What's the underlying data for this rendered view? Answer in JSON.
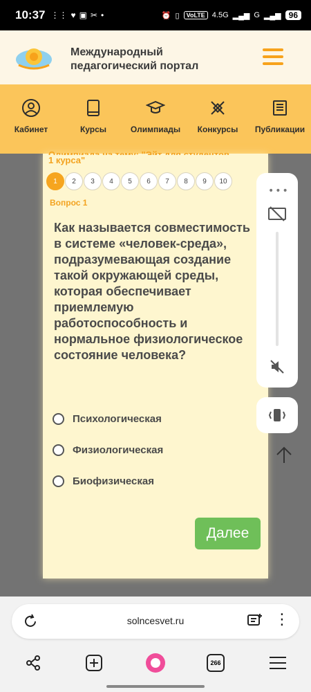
{
  "status_bar": {
    "time": "10:37",
    "volte": "VoLTE",
    "net_45g": "4.5G",
    "net_g": "G",
    "battery": "96"
  },
  "header": {
    "title_line1": "Международный",
    "title_line2": "педагогический портал"
  },
  "nav": {
    "items": [
      {
        "label": "Кабинет",
        "icon": "user-circle-icon"
      },
      {
        "label": "Курсы",
        "icon": "book-icon"
      },
      {
        "label": "Олимпиады",
        "icon": "graduation-cap-icon"
      },
      {
        "label": "Конкурсы",
        "icon": "pen-tools-icon"
      },
      {
        "label": "Публикации",
        "icon": "newspaper-icon"
      }
    ]
  },
  "quiz": {
    "subtitle_line1": "Олимпиада на тему: \"Эйт для студентов",
    "subtitle_line2": "1 курса\"",
    "pages": [
      "1",
      "2",
      "3",
      "4",
      "5",
      "6",
      "7",
      "8",
      "9",
      "10"
    ],
    "active_page": "1",
    "question_number": "Вопрос 1",
    "question_text": "Как называется совместимость в системе «человек-среда», подразумевающая создание такой окружающей среды, которая обеспечивает приемлемую работоспособность и нормальное физиологическое состояние человека?",
    "options": [
      "Психологическая",
      "Физиологическая",
      "Биофизическая"
    ],
    "next_label": "Далее"
  },
  "browser": {
    "url": "solncesvet.ru",
    "tabs_count": "266"
  },
  "colors": {
    "accent_orange": "#f6a51f",
    "nav_yellow": "#fbc55a",
    "button_green": "#6fbf59"
  }
}
